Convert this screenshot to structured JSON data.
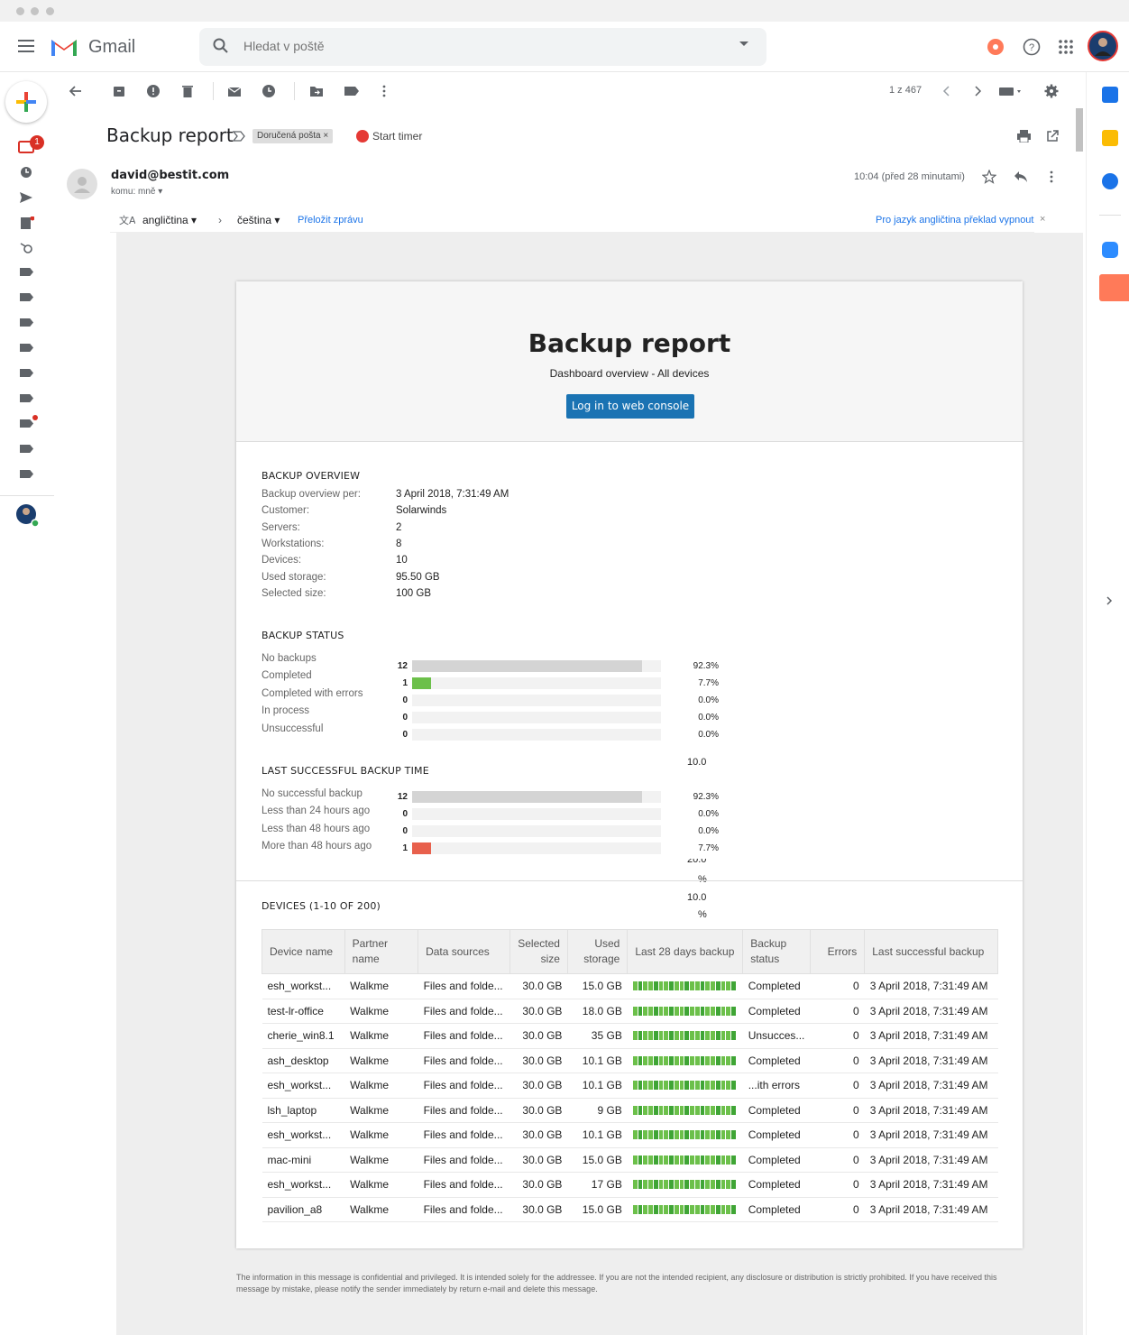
{
  "header": {
    "app_name": "Gmail",
    "search_placeholder": "Hledat v poště"
  },
  "toolbar": {
    "pager": "1 z 467"
  },
  "compose_badge": "1",
  "message": {
    "subject": "Backup report",
    "label_chip": "Doručená pošta ×",
    "start_timer": "Start timer",
    "sender": "david@bestit.com",
    "recipient": "komu: mně ▾",
    "timestamp": "10:04 (před 28 minutami)"
  },
  "translate": {
    "source_lang": "angličtina",
    "target_lang": "čeština",
    "translate_link": "Přeložit zprávu",
    "turn_off_link": "Pro jazyk angličtina překlad vypnout"
  },
  "report": {
    "title": "Backup report",
    "subtitle": "Dashboard overview - All devices",
    "console_button": "Log in to web console",
    "overview": {
      "heading": "BACKUP OVERVIEW",
      "rows": [
        {
          "label": "Backup overview per:",
          "value": "3 April 2018, 7:31:49 AM"
        },
        {
          "label": "Customer:",
          "value": "Solarwinds"
        },
        {
          "label": "Servers:",
          "value": "2"
        },
        {
          "label": "Workstations:",
          "value": "8"
        },
        {
          "label": "Devices:",
          "value": "10"
        },
        {
          "label": "Used storage:",
          "value": "95.50 GB"
        },
        {
          "label": "Selected size:",
          "value": "100 GB"
        }
      ]
    },
    "status": {
      "heading": "BACKUP STATUS",
      "rows": [
        {
          "label": "No backups",
          "count": "12",
          "pct": "92.3%",
          "fraction": 0.923,
          "color": "#d4d4d4"
        },
        {
          "label": "Completed",
          "count": "1",
          "pct": "7.7%",
          "fraction": 0.077,
          "color": "#6cc04a"
        },
        {
          "label": "Completed with errors",
          "count": "0",
          "pct": "0.0%",
          "fraction": 0,
          "color": "#f5a623"
        },
        {
          "label": "In process",
          "count": "0",
          "pct": "0.0%",
          "fraction": 0,
          "color": "#4a90d9"
        },
        {
          "label": "Unsuccessful",
          "count": "0",
          "pct": "0.0%",
          "fraction": 0,
          "color": "#e8604c"
        }
      ]
    },
    "last_backup": {
      "heading": "LAST SUCCESSFUL BACKUP TIME",
      "rows": [
        {
          "label": "No successful backup",
          "count": "12",
          "pct": "92.3%",
          "fraction": 0.923,
          "color": "#d4d4d4"
        },
        {
          "label": "Less than 24 hours ago",
          "count": "0",
          "pct": "0.0%",
          "fraction": 0,
          "color": "#6cc04a"
        },
        {
          "label": "Less than 48 hours ago",
          "count": "0",
          "pct": "0.0%",
          "fraction": 0,
          "color": "#f5a623"
        },
        {
          "label": "More than 48 hours ago",
          "count": "1",
          "pct": "7.7%",
          "fraction": 0.077,
          "color": "#e8604c"
        }
      ]
    },
    "stray_text": [
      "10.0",
      "20.0",
      "%",
      "10.0",
      "%"
    ],
    "devices": {
      "heading": "DEVICES  (1-10 OF 200)",
      "columns": [
        "Device name",
        "Partner name",
        "Data sources",
        "Selected size",
        "Used storage",
        "Last 28 days backup",
        "Backup status",
        "Errors",
        "Last successful backup"
      ],
      "rows": [
        [
          "esh_workst...",
          "Walkme",
          "Files and folde...",
          "30.0 GB",
          "15.0 GB",
          "",
          "Completed",
          "0",
          "3 April 2018, 7:31:49 AM"
        ],
        [
          "test-lr-office",
          "Walkme",
          "Files and folde...",
          "30.0 GB",
          "18.0 GB",
          "",
          "Completed",
          "0",
          "3 April 2018, 7:31:49 AM"
        ],
        [
          "cherie_win8.1",
          "Walkme",
          "Files and folde...",
          "30.0 GB",
          "35 GB",
          "",
          "Unsucces...",
          "0",
          "3 April 2018, 7:31:49 AM"
        ],
        [
          "ash_desktop",
          "Walkme",
          "Files and folde...",
          "30.0 GB",
          "10.1 GB",
          "",
          "Completed",
          "0",
          "3 April 2018, 7:31:49 AM"
        ],
        [
          "esh_workst...",
          "Walkme",
          "Files and folde...",
          "30.0 GB",
          "10.1 GB",
          "",
          "...ith errors",
          "0",
          "3 April 2018, 7:31:49 AM"
        ],
        [
          "lsh_laptop",
          "Walkme",
          "Files and folde...",
          "30.0 GB",
          "9 GB",
          "",
          "Completed",
          "0",
          "3 April 2018, 7:31:49 AM"
        ],
        [
          "esh_workst...",
          "Walkme",
          "Files and folde...",
          "30.0 GB",
          "10.1 GB",
          "",
          "Completed",
          "0",
          "3 April 2018, 7:31:49 AM"
        ],
        [
          "mac-mini",
          "Walkme",
          "Files and folde...",
          "30.0 GB",
          "15.0 GB",
          "",
          "Completed",
          "0",
          "3 April 2018, 7:31:49 AM"
        ],
        [
          "esh_workst...",
          "Walkme",
          "Files and folde...",
          "30.0 GB",
          "17 GB",
          "",
          "Completed",
          "0",
          "3 April 2018, 7:31:49 AM"
        ],
        [
          "pavilion_a8",
          "Walkme",
          "Files and folde...",
          "30.0 GB",
          "15.0 GB",
          "",
          "Completed",
          "0",
          "3 April 2018, 7:31:49 AM"
        ]
      ]
    },
    "footer": "The information in this message is confidential and privileged. It is intended solely for the addressee. If you are not the intended recipient, any disclosure or distribution is strictly prohibited. If you have received this message by mistake, please notify the sender immediately by return e-mail and delete this message."
  },
  "icons": {
    "toolbar": [
      "back-arrow-icon",
      "archive-icon",
      "report-spam-icon",
      "delete-icon",
      "mark-unread-icon",
      "snooze-icon",
      "move-to-icon",
      "label-icon",
      "more-vert-icon"
    ],
    "right_rail": [
      "calendar-icon",
      "keep-icon",
      "tasks-icon",
      "zoom-icon",
      "hubspot-icon"
    ]
  },
  "colors": {
    "console_button": "#1a73b3",
    "bar_grey": "#d4d4d4",
    "bar_green": "#6cc04a",
    "bar_red": "#e8604c",
    "link_blue": "#1a73e8"
  }
}
